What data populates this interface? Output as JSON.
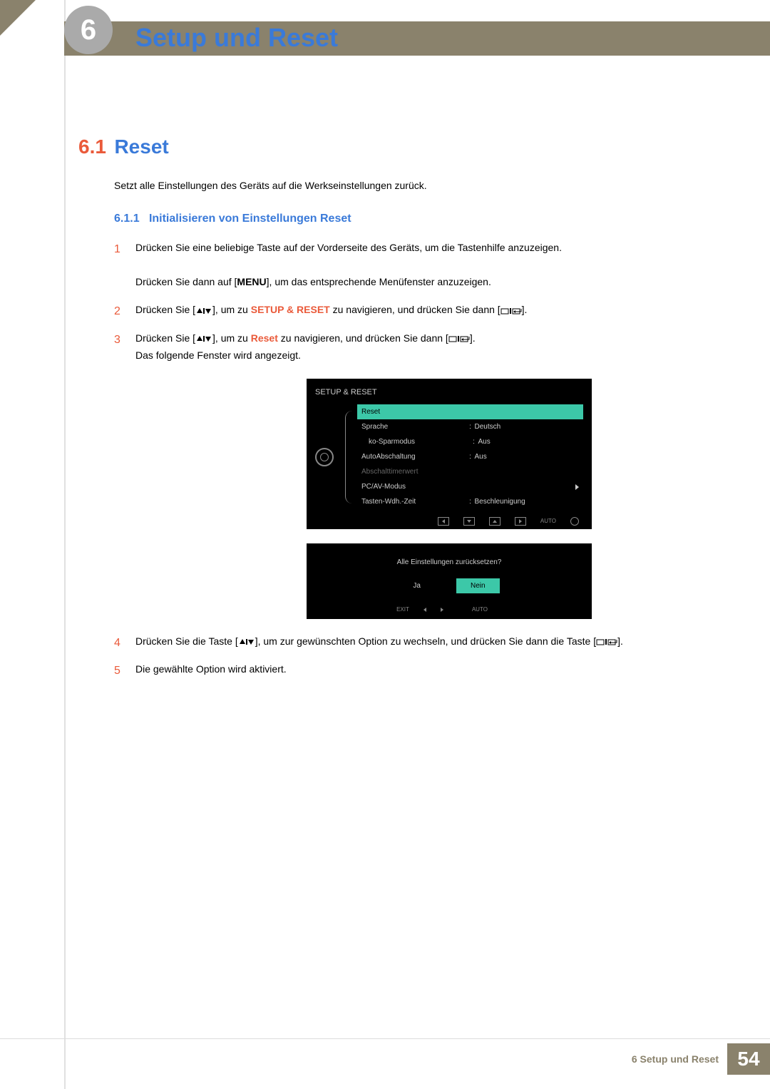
{
  "header": {
    "chapter_number": "6",
    "chapter_title": "Setup und Reset"
  },
  "section": {
    "number": "6.1",
    "title": "Reset",
    "intro": "Setzt alle Einstellungen des Geräts auf die Werkseinstellungen zurück."
  },
  "subsection": {
    "number": "6.1.1",
    "title": "Initialisieren von Einstellungen Reset"
  },
  "steps": {
    "s1": {
      "num": "1",
      "line1": "Drücken Sie eine beliebige Taste auf der Vorderseite des Geräts, um die Tastenhilfe anzuzeigen.",
      "line2_a": "Drücken Sie dann auf [",
      "menu_key": "MENU",
      "line2_b": "], um das entsprechende Menüfenster anzuzeigen."
    },
    "s2": {
      "num": "2",
      "a": "Drücken Sie [",
      "b": "], um zu ",
      "kw": "SETUP & RESET",
      "c": " zu navigieren, und drücken Sie dann [",
      "d": "]."
    },
    "s3": {
      "num": "3",
      "a": "Drücken Sie [",
      "b": "], um zu ",
      "kw": "Reset",
      "c": " zu navigieren, und drücken Sie dann [",
      "d": "].",
      "e": "Das folgende Fenster wird angezeigt."
    },
    "s4": {
      "num": "4",
      "a": "Drücken Sie die Taste [",
      "b": "], um zur gewünschten Option zu wechseln, und drücken Sie dann die Taste [",
      "c": "]."
    },
    "s5": {
      "num": "5",
      "text": "Die gewählte Option wird aktiviert."
    }
  },
  "osd": {
    "title": "SETUP & RESET",
    "items": {
      "reset": "Reset",
      "sprache": "Sprache",
      "sprache_val": "Deutsch",
      "eco": "ko-Sparmodus",
      "eco_val": "Aus",
      "auto_off": "AutoAbschaltung",
      "auto_off_val": "Aus",
      "timer": "Abschalttimerwert",
      "pcav": "PC/AV-Modus",
      "repeat": "Tasten-Wdh.-Zeit",
      "repeat_val": "Beschleunigung"
    },
    "auto_label": "AUTO"
  },
  "osd2": {
    "prompt": "Alle Einstellungen zurücksetzen?",
    "yes": "Ja",
    "no": "Nein",
    "exit": "EXIT",
    "auto": "AUTO"
  },
  "footer": {
    "text": "6 Setup und Reset",
    "page": "54"
  }
}
